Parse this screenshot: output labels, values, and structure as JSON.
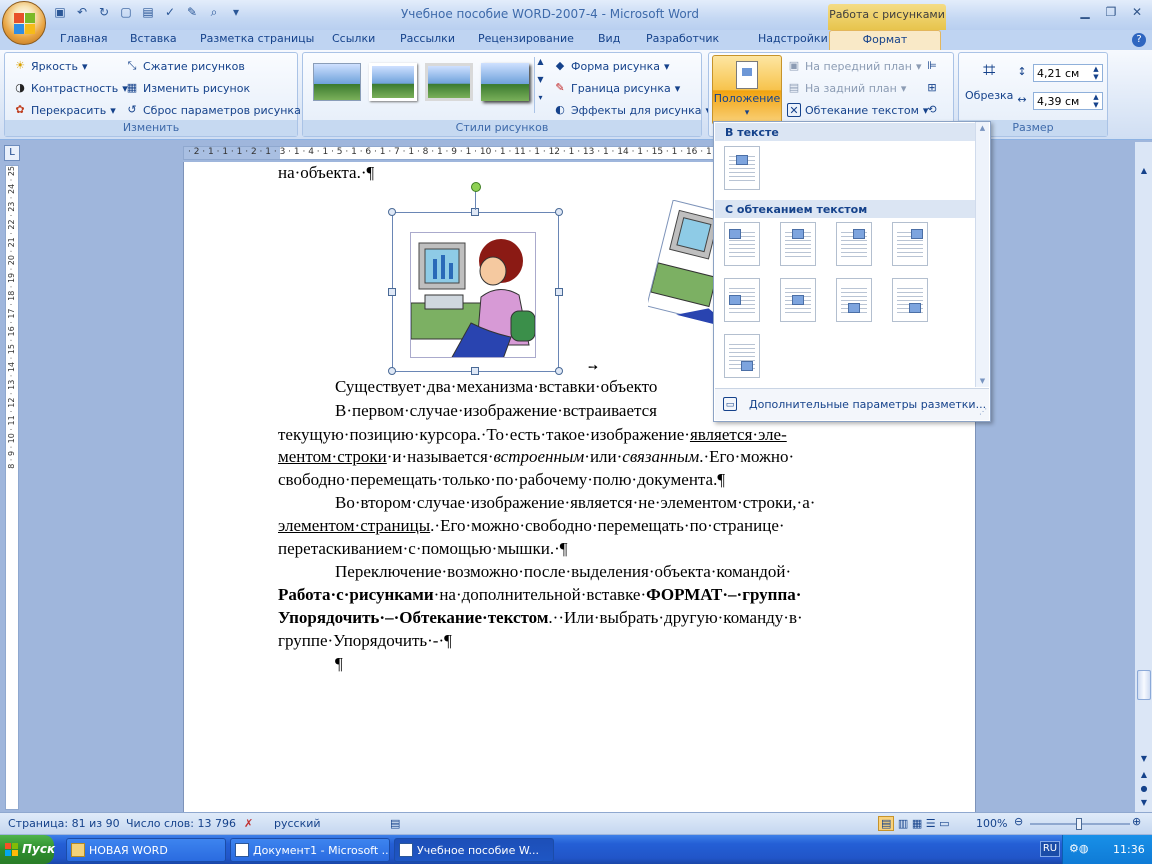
{
  "app": {
    "title": "Учебное пособие WORD-2007-4 - Microsoft Word",
    "context_tab_title": "Работа с рисунками"
  },
  "tabs": [
    "Главная",
    "Вставка",
    "Разметка страницы",
    "Ссылки",
    "Рассылки",
    "Рецензирование",
    "Вид",
    "Разработчик",
    "Надстройки",
    "Формат"
  ],
  "ribbon": {
    "adjust": {
      "label": "Изменить",
      "brightness": "Яркость",
      "contrast": "Контрастность",
      "recolor": "Перекрасить",
      "compress": "Сжатие рисунков",
      "change": "Изменить рисунок",
      "reset": "Сброс параметров рисунка"
    },
    "styles": {
      "label": "Стили рисунков",
      "shape": "Форма рисунка",
      "border": "Граница рисунка",
      "effects": "Эффекты для рисунка"
    },
    "arrange": {
      "position": "Положение",
      "bring_front": "На передний план",
      "send_back": "На задний план",
      "wrap": "Обтекание текстом"
    },
    "size": {
      "label": "Размер",
      "crop": "Обрезка",
      "height": "4,21 см",
      "width": "4,39 см"
    }
  },
  "ruler": {
    "horizontal": "· 2 · 1 · 1 · 1 · 2 · 1 · 3 · 1 · 4 · 1 · 5 · 1 · 6 · 1 · 7 · 1 · 8 · 1 · 9 · 1 · 10 · 1 · 11 · 1 · 12 · 1 · 13 · 1 · 14 · 1 · 15 · 1 · 16 · 1 · 17 ·",
    "vertical": "8 · 9 · 10 · 11 · 12 · 13 · 14 · 15 · 16 · 17 · 18 · 19 · 20 · 21 · 22 · 23 · 24 · 25"
  },
  "document": {
    "line0": "на·объекта.·¶",
    "p1": "Существует·два·механизма·вставки·объекто",
    "p2_l1": "В·первом·случае·изображение·встраивается",
    "p2_l2a": "текущую·позицию·курсора.·То·есть·такое·изображение·",
    "p2_l2b": "является·эле-",
    "p2_l3a": "ментом·строки",
    "p2_l3b": "·и·называется·",
    "p2_l3c": "встроенным",
    "p2_l3d": "·или·",
    "p2_l3e": "связанным",
    "p2_l3f": ".·Его·можно·",
    "p2_l4": "свободно·перемещать·только·по·рабочему·полю·документа.¶",
    "p3_l1": "Во·втором·случае·изображение·является·не·элементом·строки,·а·",
    "p3_l2a": "элементом·страницы",
    "p3_l2b": ".·Его·можно·свободно·перемещать·по·странице·",
    "p3_l3": "перетаскиванием·с·помощью·мышки.·¶",
    "p4_l1": "Переключение·возможно·после·выделения·объекта·командой·",
    "p4_l2a": "Работа·с·рисунками",
    "p4_l2b": "·на·дополнительной·вставке·",
    "p4_l2c": "ФОРМАТ·–·группа·",
    "p4_l3a": "Упорядочить·–·Обтекание·текстом",
    "p4_l3b": ".··Или·выбрать·другую·команду·в·",
    "p4_l4": "группе·Упорядочить·-·¶",
    "p5": "¶"
  },
  "dropdown": {
    "section1": "В тексте",
    "section2": "С обтеканием текстом",
    "footer": "Дополнительные параметры разметки..."
  },
  "status": {
    "page": "Страница: 81 из 90",
    "words": "Число слов: 13 796",
    "lang": "русский",
    "zoom": "100%"
  },
  "taskbar": {
    "start": "Пуск",
    "items": [
      "НОВАЯ WORD",
      "Документ1 - Microsoft ...",
      "Учебное пособие W..."
    ],
    "lang": "RU",
    "time": "11:36"
  }
}
